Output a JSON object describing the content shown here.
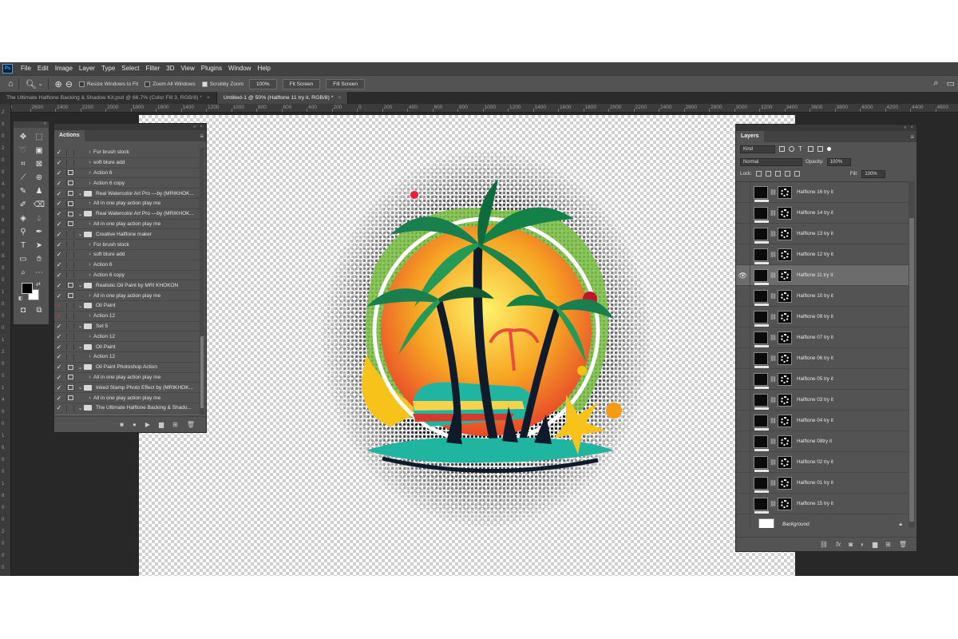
{
  "app": {
    "logo": "Ps"
  },
  "menu": [
    "File",
    "Edit",
    "Image",
    "Layer",
    "Type",
    "Select",
    "Filter",
    "3D",
    "View",
    "Plugins",
    "Window",
    "Help"
  ],
  "options": {
    "resize_windows": "Resize Windows to Fit",
    "zoom_all": "Zoom All Windows",
    "scrubby_zoom": "Scrubby Zoom",
    "zoom_100": "100%",
    "fit_screen": "Fit Screen",
    "fill_screen": "Fill Screen"
  },
  "tabs": [
    {
      "title": "The Ultimate Halftone Backing & Shadow Kit.psd @ 66.7% (Color Fill 3, RGB/8) *",
      "active": false
    },
    {
      "title": "Untitled-1 @ 50% (Halftone 11 try it, RGB/8) *",
      "active": true
    }
  ],
  "ruler_top": [
    "10",
    "2600",
    "2400",
    "2200",
    "2000",
    "1800",
    "1600",
    "1400",
    "1200",
    "1000",
    "800",
    "600",
    "400",
    "200",
    "0",
    "200",
    "400",
    "600",
    "800",
    "1000",
    "1200",
    "1400",
    "1600",
    "1800",
    "2000",
    "2200",
    "2400",
    "2600",
    "2800",
    "3000",
    "3200",
    "3400",
    "3600",
    "3800",
    "4000",
    "4200",
    "4400",
    "4600"
  ],
  "ruler_left": [
    "2",
    "0",
    "0",
    "2",
    "0",
    "0",
    "4",
    "0",
    "0",
    "6",
    "0",
    "0",
    "8",
    "0",
    "0",
    "1",
    "0",
    "0",
    "0",
    "1",
    "2",
    "0",
    "0",
    "1",
    "4",
    "0",
    "0",
    "1",
    "6",
    "0",
    "0",
    "1",
    "8",
    "0",
    "0",
    "2",
    "0",
    "0",
    "0"
  ],
  "actions_panel": {
    "tab": "Actions",
    "rows": [
      {
        "label": "For brush stock",
        "level": 2,
        "type": "action",
        "check": "on",
        "dialog": false
      },
      {
        "label": "soft blure add",
        "level": 2,
        "type": "action",
        "check": "on",
        "dialog": false
      },
      {
        "label": "Action 6",
        "level": 2,
        "type": "action",
        "check": "on",
        "dialog": true
      },
      {
        "label": "Action 6 copy",
        "level": 2,
        "type": "action",
        "check": "on",
        "dialog": true
      },
      {
        "label": "Real Watercolor Art Pro —by (MRIKHOK...",
        "level": 1,
        "type": "set",
        "check": "on",
        "dialog": true
      },
      {
        "label": "All in one play action play me",
        "level": 2,
        "type": "action",
        "check": "on",
        "dialog": true
      },
      {
        "label": "Real Watercolor Art Pro —by (MRIKHOK...",
        "level": 1,
        "type": "set",
        "check": "on",
        "dialog": true
      },
      {
        "label": "All in one play action play me",
        "level": 2,
        "type": "action",
        "check": "on",
        "dialog": true
      },
      {
        "label": "Creative Halftone maker",
        "level": 1,
        "type": "set",
        "check": "on",
        "dialog": false
      },
      {
        "label": "For brush stock",
        "level": 2,
        "type": "action",
        "check": "on",
        "dialog": false
      },
      {
        "label": "soft blure add",
        "level": 2,
        "type": "action",
        "check": "on",
        "dialog": false
      },
      {
        "label": "Action 6",
        "level": 2,
        "type": "action",
        "check": "on",
        "dialog": false
      },
      {
        "label": "Action 6 copy",
        "level": 2,
        "type": "action",
        "check": "on",
        "dialog": false
      },
      {
        "label": "Realistic Oil Paint by MRI KHOKON",
        "level": 1,
        "type": "set",
        "check": "on",
        "dialog": true
      },
      {
        "label": "All in one play action play me",
        "level": 2,
        "type": "action",
        "check": "on",
        "dialog": true
      },
      {
        "label": "Oil Paint",
        "level": 1,
        "type": "set",
        "check": "red",
        "dialog": false
      },
      {
        "label": "Action 12",
        "level": 2,
        "type": "action",
        "check": "red",
        "dialog": false
      },
      {
        "label": "Set 5",
        "level": 1,
        "type": "set",
        "check": "on",
        "dialog": false
      },
      {
        "label": "Action 12",
        "level": 2,
        "type": "action",
        "check": "on",
        "dialog": false
      },
      {
        "label": "Oil Paint",
        "level": 1,
        "type": "set",
        "check": "on",
        "dialog": false
      },
      {
        "label": "Action 12",
        "level": 2,
        "type": "action",
        "check": "on",
        "dialog": false
      },
      {
        "label": "Oil Paint Photoshop Action",
        "level": 1,
        "type": "set",
        "check": "on",
        "dialog": true
      },
      {
        "label": "All in one play action play me",
        "level": 2,
        "type": "action",
        "check": "on",
        "dialog": true
      },
      {
        "label": "Inked Stamp Photo Effect by (MRIKHOK...",
        "level": 1,
        "type": "set",
        "check": "on",
        "dialog": true
      },
      {
        "label": "All in one play action play me",
        "level": 2,
        "type": "action",
        "check": "on",
        "dialog": true
      },
      {
        "label": "The Ultimate Halftone Backing & Shado...",
        "level": 1,
        "type": "set",
        "check": "on",
        "dialog": false
      },
      {
        "label": "All in one play action play me",
        "level": 2,
        "type": "action",
        "check": "on",
        "dialog": false,
        "selected": true
      }
    ]
  },
  "layers_panel": {
    "tab": "Layers",
    "filter_kind": "Kind",
    "blend_mode": "Normal",
    "opacity_label": "Opacity:",
    "opacity_value": "100%",
    "lock_label": "Lock:",
    "fill_label": "Fill:",
    "fill_value": "100%",
    "layers": [
      {
        "name": "Halftone 16 try it",
        "visible": false,
        "selected": false
      },
      {
        "name": "Halftone 14 try it",
        "visible": false,
        "selected": false
      },
      {
        "name": "Halftone 13 try it",
        "visible": false,
        "selected": false
      },
      {
        "name": "Halftone 12 try it",
        "visible": false,
        "selected": false
      },
      {
        "name": "Halftone 11 try it",
        "visible": true,
        "selected": true
      },
      {
        "name": "Halftone 10 try it",
        "visible": false,
        "selected": false
      },
      {
        "name": "Halftone 09 try it",
        "visible": false,
        "selected": false
      },
      {
        "name": "Halftone 07 try it",
        "visible": false,
        "selected": false
      },
      {
        "name": "Halftone 06 try it",
        "visible": false,
        "selected": false
      },
      {
        "name": "Halftone 05 try it",
        "visible": false,
        "selected": false
      },
      {
        "name": "Halftone 03 try it",
        "visible": false,
        "selected": false
      },
      {
        "name": "Halftone 04 try it",
        "visible": false,
        "selected": false
      },
      {
        "name": "Halftone 08try it",
        "visible": false,
        "selected": false
      },
      {
        "name": "Halftone 02 try it",
        "visible": false,
        "selected": false
      },
      {
        "name": "Halftone 01 try it",
        "visible": false,
        "selected": false
      },
      {
        "name": "Halftone 15 try it",
        "visible": false,
        "selected": false
      }
    ],
    "background_layer": "Background"
  },
  "colors": {
    "foreground": "#000000",
    "background": "#ffffff",
    "accent": "#31a8ff"
  }
}
